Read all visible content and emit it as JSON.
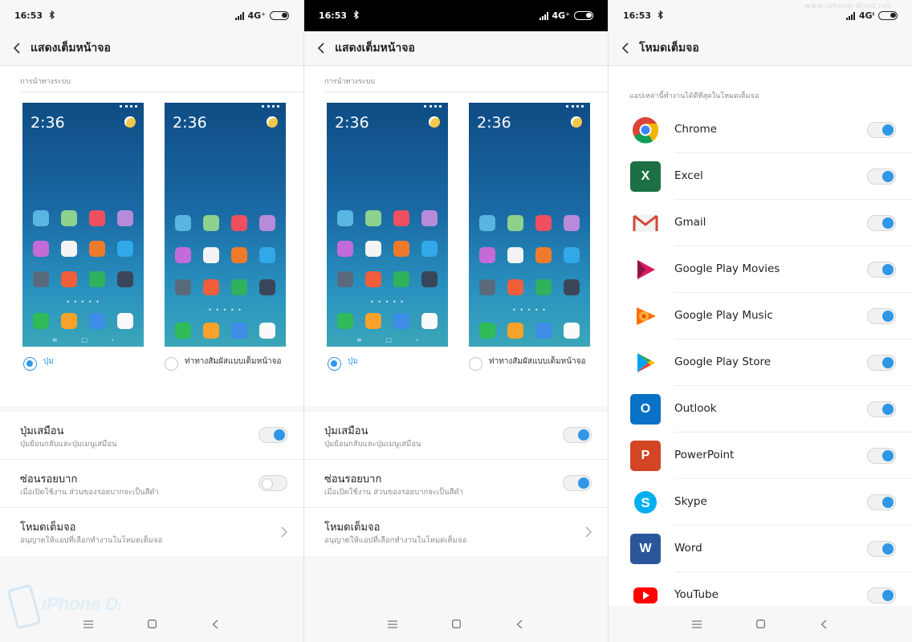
{
  "status": {
    "time": "16:53",
    "network": "4G⁺",
    "network_alt": "4Gⁱ"
  },
  "watermark": {
    "url": "www.iphone-droid.net",
    "logo_text": "iPhone Droid"
  },
  "screen1": {
    "title": "แสดงเต็มหน้าจอ",
    "section_label": "การนำทางระบบ",
    "preview_clock": "2:36",
    "option_buttons": "ปุ่ม",
    "option_gestures": "ท่าทางสัมผัสแบบเต็มหน้าจอ",
    "selected_option": "buttons",
    "rows": [
      {
        "title": "ปุ่มเสมือน",
        "subtitle": "ปุ่มย้อนกลับและปุ่มเมนูเสมือน",
        "toggle": "on"
      },
      {
        "title": "ซ่อนรอยบาก",
        "subtitle": "เมื่อเปิดใช้งาน ส่วนของรอยบากจะเป็นสีดำ",
        "toggle": "off"
      },
      {
        "title": "โหมดเต็มจอ",
        "subtitle": "อนุญาตให้แอปที่เลือกทำงานในโหมดเต็มจอ",
        "toggle": "chevron"
      }
    ]
  },
  "screen2": {
    "title": "แสดงเต็มหน้าจอ",
    "section_label": "การนำทางระบบ",
    "preview_clock": "2:36",
    "option_buttons": "ปุ่ม",
    "option_gestures": "ท่าทางสัมผัสแบบเต็มหน้าจอ",
    "selected_option": "buttons",
    "rows": [
      {
        "title": "ปุ่มเสมือน",
        "subtitle": "ปุ่มย้อนกลับและปุ่มเมนูเสมือน",
        "toggle": "on"
      },
      {
        "title": "ซ่อนรอยบาก",
        "subtitle": "เมื่อเปิดใช้งาน ส่วนของรอยบากจะเป็นสีดำ",
        "toggle": "on"
      },
      {
        "title": "โหมดเต็มจอ",
        "subtitle": "อนุญาตให้แอปที่เลือกทำงานในโหมดเต็มจอ",
        "toggle": "chevron"
      }
    ]
  },
  "screen3": {
    "title": "โหมดเต็มจอ",
    "list_label": "แอปเหล่านี้ทำงานได้ดีที่สุดในโหมดเต็มจอ",
    "apps": [
      {
        "name": "Chrome",
        "icon": "chrome-icon",
        "enabled": true
      },
      {
        "name": "Excel",
        "icon": "excel-icon",
        "enabled": true
      },
      {
        "name": "Gmail",
        "icon": "gmail-icon",
        "enabled": true
      },
      {
        "name": "Google Play Movies",
        "icon": "play-movies-icon",
        "enabled": true
      },
      {
        "name": "Google Play Music",
        "icon": "play-music-icon",
        "enabled": true
      },
      {
        "name": "Google Play Store",
        "icon": "play-store-icon",
        "enabled": true
      },
      {
        "name": "Outlook",
        "icon": "outlook-icon",
        "enabled": true
      },
      {
        "name": "PowerPoint",
        "icon": "powerpoint-icon",
        "enabled": true
      },
      {
        "name": "Skype",
        "icon": "skype-icon",
        "enabled": true
      },
      {
        "name": "Word",
        "icon": "word-icon",
        "enabled": true
      },
      {
        "name": "YouTube",
        "icon": "youtube-icon",
        "enabled": true
      }
    ]
  },
  "colors": {
    "accent": "#2f97e6",
    "background": "#f7f7f7"
  }
}
